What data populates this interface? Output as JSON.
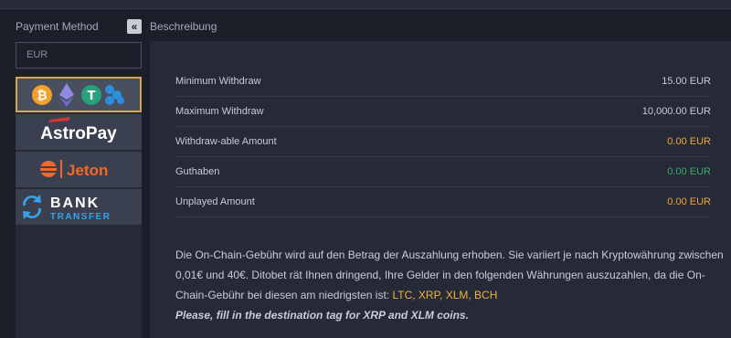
{
  "sidebar": {
    "title": "Payment Method",
    "collapse_icon": "«",
    "currency": "EUR",
    "methods": [
      {
        "name": "crypto",
        "label": ""
      },
      {
        "name": "astropay",
        "label": "AstroPay"
      },
      {
        "name": "jeton",
        "label": "Jeton"
      },
      {
        "name": "bank-transfer",
        "label_top": "BANK",
        "label_bottom": "TRANSFER"
      }
    ]
  },
  "main": {
    "title": "Beschreibung",
    "rows": [
      {
        "label": "Minimum Withdraw",
        "value": "15.00 EUR"
      },
      {
        "label": "Maximum Withdraw",
        "value": "10,000.00 EUR"
      },
      {
        "label": "Withdraw-able Amount",
        "value": "0.00 EUR"
      },
      {
        "label": "Guthaben",
        "value": "0.00 EUR"
      },
      {
        "label": "Unplayed Amount",
        "value": "0.00 EUR"
      }
    ],
    "note_text": "Die On-Chain-Gebühr wird auf den Betrag der Auszahlung erhoben. Sie variiert je nach Kryptowährung zwischen 0,01€ und 40€. Ditobet rät Ihnen dringend, Ihre Gelder in den folgenden Währungen auszuzahlen, da die On-Chain-Gebühr bei diesen am niedrigsten ist: ",
    "note_coins": "LTC, XRP, XLM, BCH",
    "note_tag": "Please, fill in the destination tag for XRP and XLM coins."
  },
  "colors": {
    "background": "#1c1f2a",
    "panel": "#262a36",
    "accent_gold": "#d8a845",
    "value_orange": "#f0a63a",
    "value_green": "#3ea86a"
  }
}
